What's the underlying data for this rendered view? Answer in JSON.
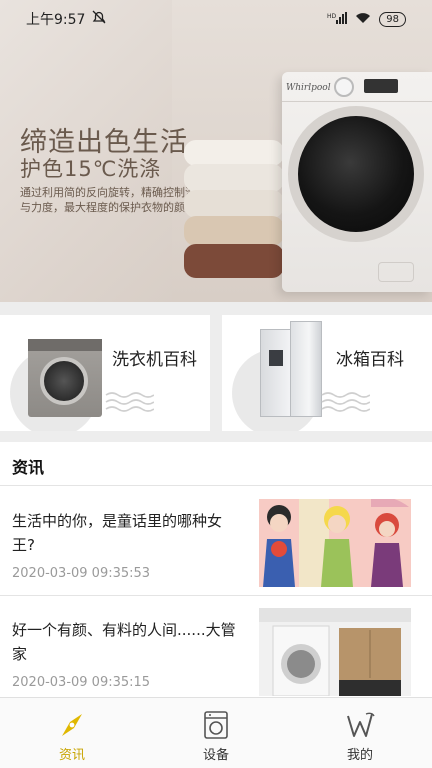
{
  "status_bar": {
    "time": "上午9:57",
    "network": "HD",
    "battery": "98"
  },
  "hero": {
    "title": "缔造出色生活",
    "subtitle": "护色15℃洗涤",
    "description": "通过利用简的反向旋转，精确控制洗涤角度与力度，最大程度的保护衣物的颜色",
    "brand": "Whirlpool"
  },
  "categories": [
    {
      "label": "洗衣机百科",
      "icon": "washing-machine"
    },
    {
      "label": "冰箱百科",
      "icon": "refrigerator"
    }
  ],
  "news": {
    "heading": "资讯",
    "items": [
      {
        "title": "生活中的你，是童话里的哪种女王?",
        "time": "2020-03-09 09:35:53"
      },
      {
        "title": "好一个有颜、有料的人间......大管家",
        "time": "2020-03-09 09:35:15"
      }
    ]
  },
  "nav": {
    "items": [
      {
        "label": "资讯",
        "icon": "compass-icon",
        "active": true
      },
      {
        "label": "设备",
        "icon": "washing-machine-icon",
        "active": false
      },
      {
        "label": "我的",
        "icon": "w-logo-icon",
        "active": false
      }
    ],
    "active_color": "#c8a400"
  }
}
